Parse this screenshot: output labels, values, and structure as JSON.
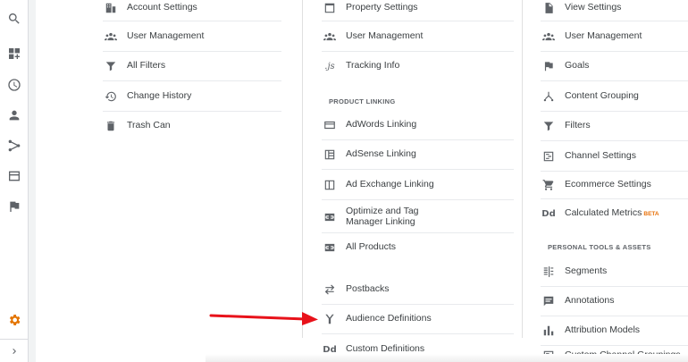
{
  "columns": {
    "account": {
      "items": [
        {
          "label": "Account Settings",
          "icon": "building-icon"
        },
        {
          "label": "User Management",
          "icon": "people-icon"
        },
        {
          "label": "All Filters",
          "icon": "filter-icon"
        },
        {
          "label": "Change History",
          "icon": "history-icon"
        },
        {
          "label": "Trash Can",
          "icon": "trash-icon"
        }
      ]
    },
    "property": {
      "items": [
        {
          "label": "Property Settings",
          "icon": "square-icon"
        },
        {
          "label": "User Management",
          "icon": "people-icon"
        },
        {
          "label": "Tracking Info",
          "icon": "js-icon",
          "icon_text": ".js"
        }
      ],
      "section_header": "PRODUCT LINKING",
      "linking": [
        {
          "label": "AdWords Linking",
          "icon": "adwords-icon"
        },
        {
          "label": "AdSense Linking",
          "icon": "adsense-icon"
        },
        {
          "label": "Ad Exchange Linking",
          "icon": "adexchange-icon"
        },
        {
          "label": "Optimize and Tag Manager Linking",
          "icon": "link-icon"
        },
        {
          "label": "All Products",
          "icon": "link-icon"
        }
      ],
      "more": [
        {
          "label": "Postbacks",
          "icon": "postback-icon"
        },
        {
          "label": "Audience Definitions",
          "icon": "audience-icon"
        },
        {
          "label": "Custom Definitions",
          "icon": "dd-icon",
          "icon_text": "Dd"
        }
      ]
    },
    "view": {
      "items": [
        {
          "label": "View Settings",
          "icon": "file-icon"
        },
        {
          "label": "User Management",
          "icon": "people-icon"
        },
        {
          "label": "Goals",
          "icon": "flag-icon"
        },
        {
          "label": "Content Grouping",
          "icon": "grouping-icon"
        },
        {
          "label": "Filters",
          "icon": "filter-icon"
        },
        {
          "label": "Channel Settings",
          "icon": "channel-icon"
        },
        {
          "label": "Ecommerce Settings",
          "icon": "cart-icon"
        },
        {
          "label": "Calculated Metrics",
          "icon": "dd-icon",
          "icon_text": "Dd",
          "badge": "BETA"
        }
      ],
      "section_header": "PERSONAL TOOLS & ASSETS",
      "personal": [
        {
          "label": "Segments",
          "icon": "segments-icon"
        },
        {
          "label": "Annotations",
          "icon": "annotation-icon"
        },
        {
          "label": "Attribution Models",
          "icon": "bars-icon"
        },
        {
          "label": "Custom Channel Groupings",
          "icon": "channel-icon"
        }
      ]
    }
  },
  "rail": [
    "search-icon",
    "dashboard-icon",
    "clock-icon",
    "person-icon",
    "fork-icon",
    "display-icon",
    "flag-icon",
    "gear-icon",
    "chevron-right-icon"
  ],
  "colors": {
    "accent_gear": "#e37400",
    "arrow": "#e8121a"
  }
}
